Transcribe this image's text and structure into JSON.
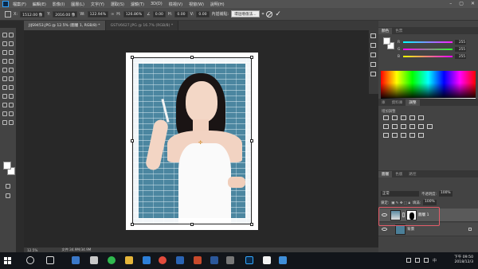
{
  "menubar": {
    "items": [
      "檔案(F)",
      "編輯(E)",
      "影像(I)",
      "圖層(L)",
      "文字(Y)",
      "選取(S)",
      "濾鏡(T)",
      "3D(D)",
      "檢視(V)",
      "視窗(W)",
      "說明(H)"
    ]
  },
  "options_bar": {
    "x_label": "X:",
    "x_value": "1512.00 像",
    "y_label": "Y:",
    "y_value": "2016.00 像",
    "w_label": "W:",
    "w_value": "122.94%",
    "h_label": "H:",
    "h_value": "126.86%",
    "angle_value": "0.00",
    "hskew_label": "H:",
    "hskew_value": "0.00",
    "vskew_label": "V:",
    "vskew_value": "0.00",
    "interp_label": "內插補點:",
    "interp_value": "環迴增值法...",
    "cancel_icon": "cancel-icon",
    "commit_icon": "commit-icon"
  },
  "tooltip": {
    "text": "確認變形 (Enter)"
  },
  "tabs": [
    {
      "label": "JIJS9453.JPG @ 12.5% (圖層 1, RGB/8) *",
      "active": true
    },
    {
      "label": "GSTV6627.JPG @ 16.7% (RGB/8) *",
      "active": false
    }
  ],
  "status": {
    "zoom": "12.5%",
    "doc_size": "文件:34.9M/34.9M"
  },
  "color_panel": {
    "tabs": [
      "顏色",
      "色票"
    ],
    "sliders": [
      {
        "letter": "R",
        "value": "255",
        "gradient": "#ff1aff"
      },
      {
        "letter": "G",
        "value": "255",
        "gradient": "#2bff2b"
      },
      {
        "letter": "B",
        "value": "255",
        "gradient": "#ffff00"
      }
    ],
    "fg_color": "#ffffff",
    "bg_color": "#ffffff"
  },
  "adjust_panel": {
    "tabs": [
      "庫",
      "資料庫",
      "調整"
    ],
    "active_tab": "調整",
    "add_label": "增加調整"
  },
  "layers_panel": {
    "tabs": [
      "圖層",
      "色版",
      "路徑"
    ],
    "blend_mode": "正常",
    "opacity_label": "不透明度:",
    "opacity_value": "100%",
    "lock_label": "鎖定:",
    "fill_label": "填滿:",
    "fill_value": "100%",
    "layers": [
      {
        "name": "圖層 1",
        "selected": true
      },
      {
        "name": "背景",
        "selected": false
      }
    ]
  },
  "taskbar": {
    "ime": "中",
    "time": "下午 09:50",
    "date": "2018/12/3",
    "accent": "#0078d7"
  }
}
